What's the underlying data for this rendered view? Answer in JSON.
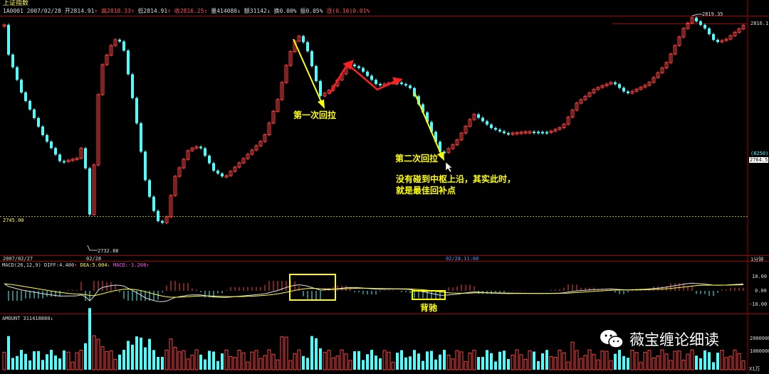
{
  "header": {
    "title": "上证指数",
    "code_date": "1A0001 2007/02/28",
    "open": "开2814.91",
    "high": "高2818.33",
    "low": "低2814.91",
    "close": "收2816.25",
    "volume": "量414080",
    "amount": "额31142",
    "turnover": "换0.00%",
    "amplitude": "振0.05%",
    "change": "涨(0.16)0.01%"
  },
  "price_axis": {
    "top_price": "2816.1",
    "cur_code": "(8250)",
    "cur_price": "2764.5",
    "ref_price": "2745.00"
  },
  "price_labels": {
    "high_mark": "2819.35",
    "low_mark": "2732.88"
  },
  "time_axis": {
    "left_date": "2007/02/27",
    "mid_date": "02/28",
    "cursor_time": "02/28,11:00",
    "period": "1分钟"
  },
  "annotations": {
    "first_pullback": "第一次回拉",
    "second_pullback": "第二次回拉",
    "note_line1": "没有碰到中枢上沿，其实此时，",
    "note_line2": "就是最佳回补点",
    "divergence": "背驰"
  },
  "macd": {
    "label": "MACD(26,12,9)",
    "diff": "DIFF:4.400",
    "dea": "DEA:5.004",
    "macd": "MACD:-1.208",
    "ticks": [
      "10.00",
      "0.00",
      "-10.00"
    ]
  },
  "amount_pane": {
    "label": "AMOUNT 311418880",
    "tick": "2000000",
    "tick2": "1000000",
    "unit": "X1万"
  },
  "watermark": {
    "text": "薇宝缠论细读",
    "icon": "wechat-icon"
  },
  "colors": {
    "up": "#ff4040",
    "down": "#55ffff",
    "annotation": "#ffff00",
    "arrow_red": "#ff2020"
  }
}
